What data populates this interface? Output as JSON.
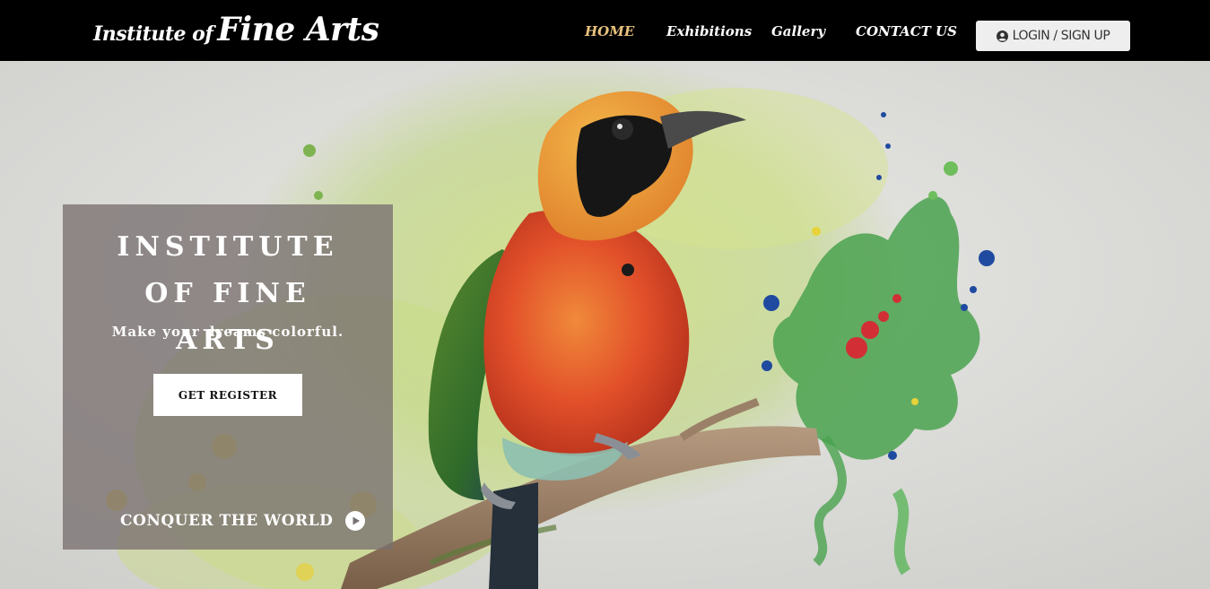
{
  "navbar": {
    "brand_prefix": "Institute of",
    "brand_main": "Fine Arts",
    "links": [
      {
        "label": "HOME",
        "active": true
      },
      {
        "label": "Exhibitions",
        "active": false
      },
      {
        "label": "Gallery",
        "active": false
      },
      {
        "label": "CONTACT US",
        "active": false
      }
    ],
    "login_label": "LOGIN / SIGN UP",
    "login_icon": "user-circle-icon",
    "active_color": "#e9c27c"
  },
  "hero": {
    "title": "INSTITUTE OF FINE ARTS",
    "subtitle": "Make your dreams colorful.",
    "register_label": "GET REGISTER",
    "conquer_label": "CONQUER THE WORLD",
    "conquer_icon": "play-circle-icon",
    "artwork": "watercolor painting of a bird perched on a branch"
  }
}
